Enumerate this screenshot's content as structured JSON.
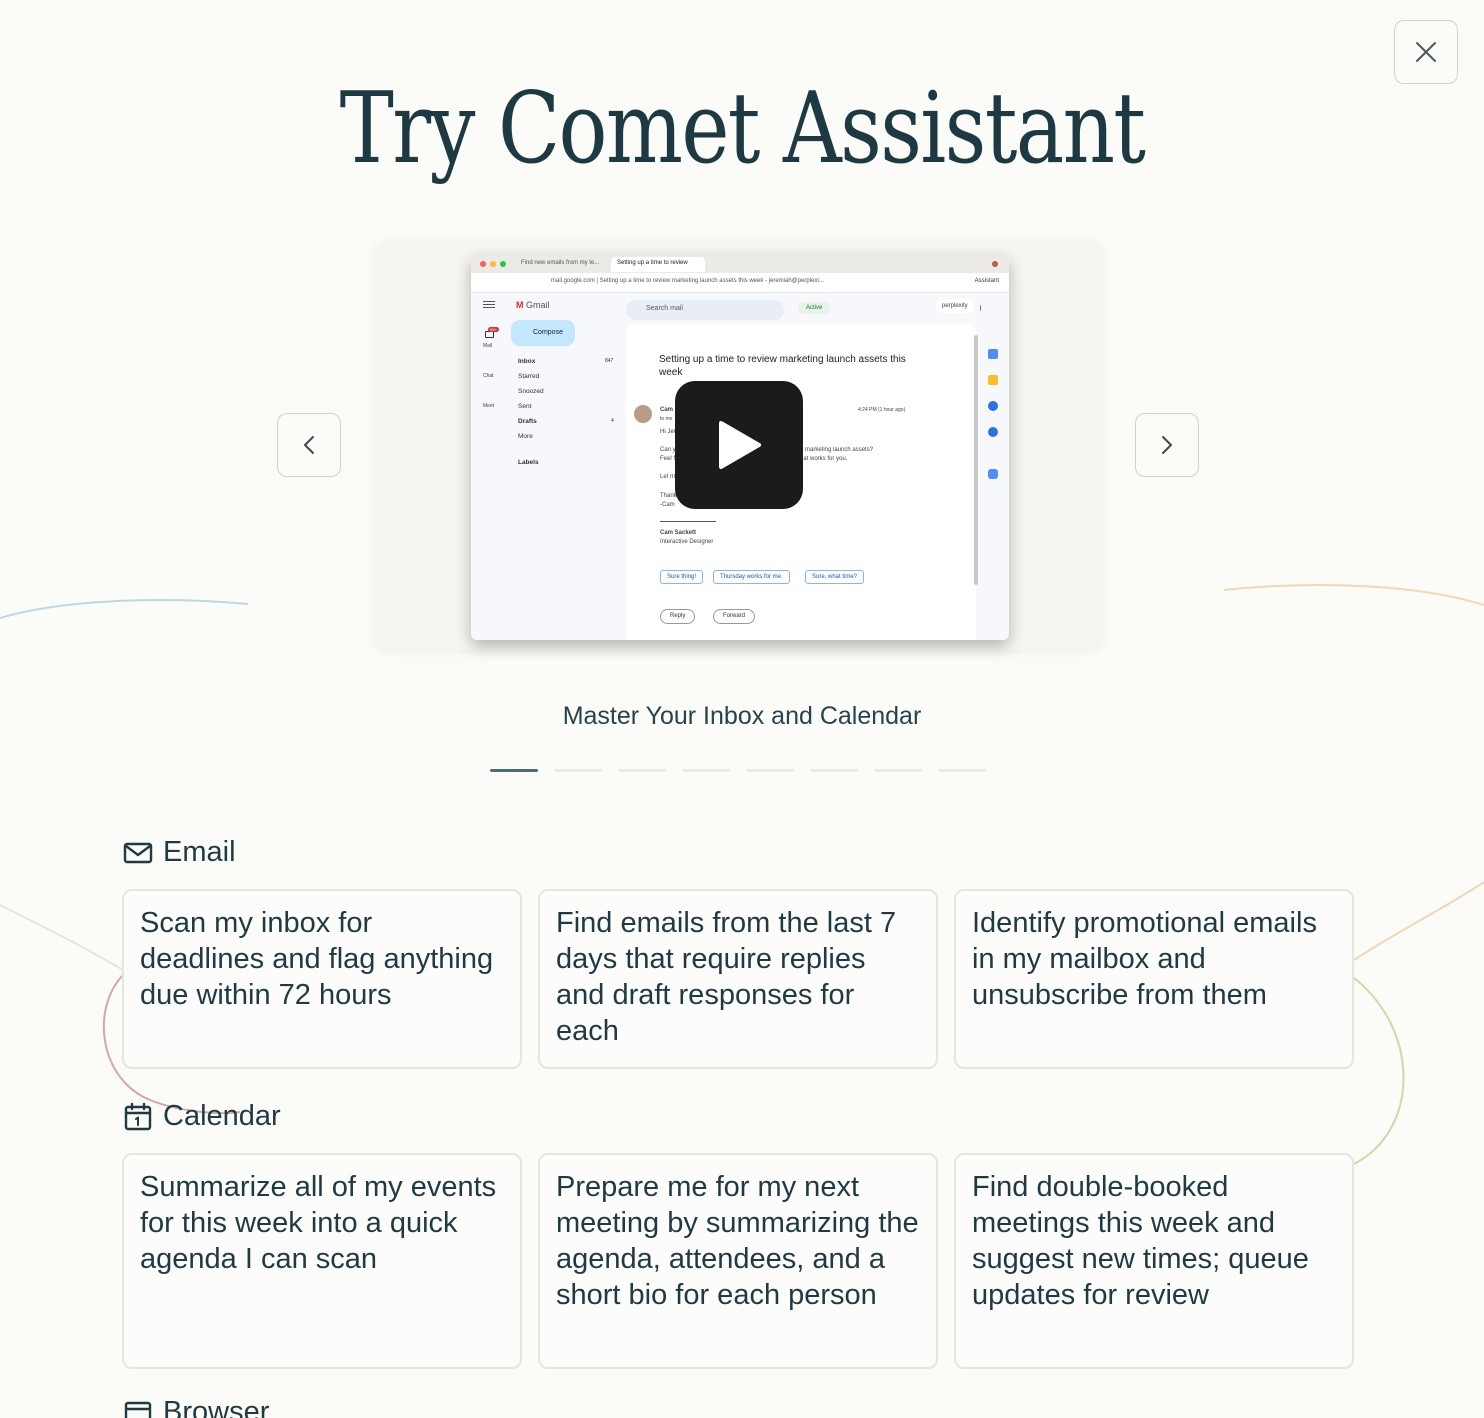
{
  "title": "Try Comet Assistant",
  "close_icon": "close-icon",
  "carousel": {
    "caption": "Master Your Inbox and Calendar",
    "prev_icon": "chevron-left-icon",
    "next_icon": "chevron-right-icon",
    "play_icon": "play-icon",
    "slide_count": 8,
    "active_index": 0,
    "video_preview": {
      "tabs": [
        "Find new emails from my te...",
        "Setting up a time to review"
      ],
      "url": "mail.google.com | Setting up a time to review marketing launch assets this week - jeremiah@perplexi...",
      "assistant_tab": "Assistant",
      "gmail_logo": "Gmail",
      "search_placeholder": "Search mail",
      "status": "Active",
      "account": "perplexity",
      "avatar_letter": "J",
      "rail": [
        "Mail",
        "Chat",
        "Meet"
      ],
      "mail_badge": "99+",
      "compose": "Compose",
      "nav": [
        {
          "label": "Inbox",
          "count": "847"
        },
        {
          "label": "Starred",
          "count": ""
        },
        {
          "label": "Snoozed",
          "count": ""
        },
        {
          "label": "Sent",
          "count": ""
        },
        {
          "label": "Drafts",
          "count": "4"
        },
        {
          "label": "More",
          "count": ""
        }
      ],
      "labels_header": "Labels",
      "subject": "Setting up a time to review marketing launch assets this week",
      "sender_short": "Cam",
      "to_me": "to me",
      "timestamp": "4:24 PM (1 hour ago)",
      "body_lines": [
        "Hi Jer",
        "Can y",
        "Feel f",
        "Let m",
        "Thanks!",
        "-Cam"
      ],
      "body_right_1": "e marketing launch assets?",
      "body_right_2": "hat works for you.",
      "signature_name": "Cam Sackett",
      "signature_title": "Interactive Designer",
      "smart_replies": [
        "Sure thing!",
        "Thursday works for me.",
        "Sure, what time?"
      ],
      "reply": "Reply",
      "forward": "Forward"
    }
  },
  "sections": [
    {
      "title": "Email",
      "icon": "mail-icon",
      "prompts": [
        "Scan my inbox for deadlines and flag anything due within 72 hours",
        "Find emails from the last 7 days that require replies and draft responses for each",
        "Identify promotional emails in my mailbox and unsubscribe from them"
      ]
    },
    {
      "title": "Calendar",
      "icon": "calendar-icon",
      "prompts": [
        "Summarize all of my events for this week into a quick agenda I can scan",
        "Prepare me for my next meeting by summarizing the agenda, attendees, and a short bio for each person",
        "Find double-booked meetings this week and suggest new times; queue updates for review"
      ]
    },
    {
      "title": "Browser",
      "icon": "browser-icon",
      "prompts": []
    }
  ]
}
